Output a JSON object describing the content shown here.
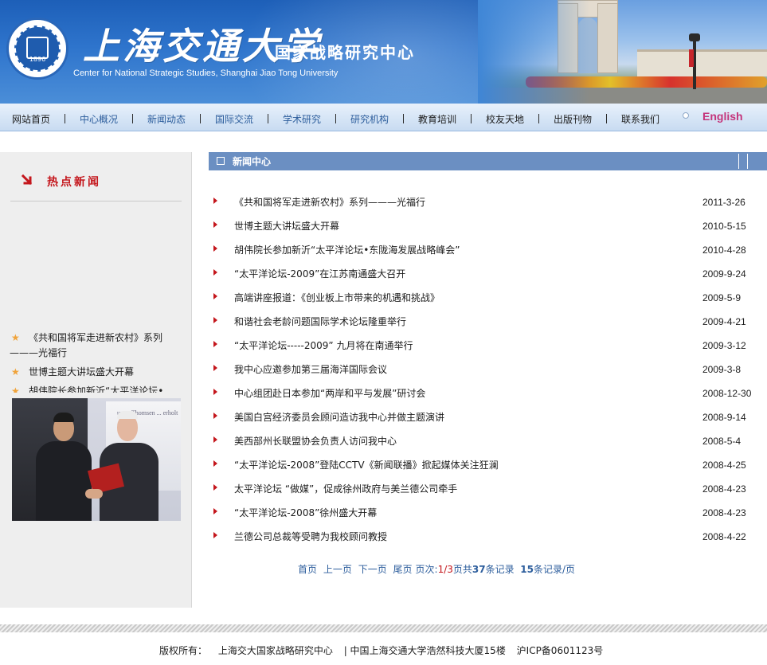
{
  "header": {
    "university_name": "上海交通大学",
    "center_name_cn": "国家战略研究中心",
    "center_name_en": "Center for National Strategic Studies, Shanghai Jiao Tong University",
    "seal_year": "1896"
  },
  "nav": {
    "items": [
      {
        "label": "网站首页"
      },
      {
        "label": "中心概况"
      },
      {
        "label": "新闻动态"
      },
      {
        "label": "国际交流"
      },
      {
        "label": "学术研究"
      },
      {
        "label": "研究机构"
      },
      {
        "label": "教育培训"
      },
      {
        "label": "校友天地"
      },
      {
        "label": "出版刊物"
      },
      {
        "label": "联系我们"
      }
    ],
    "english": "English"
  },
  "sidebar": {
    "hot_news_title": "热点新闻",
    "hot_items": [
      {
        "title": "《共和国将军走进新农村》系列———光福行"
      },
      {
        "title": "世博主题大讲坛盛大开幕"
      },
      {
        "title": "胡伟院长参加新沂“太平洋论坛•东陇海发展战略峰会”"
      }
    ],
    "photo_caption": "upon Thomsen ... erholt"
  },
  "news": {
    "section_title": "新闻中心",
    "items": [
      {
        "title": "《共和国将军走进新农村》系列———光福行",
        "date": "2011-3-26"
      },
      {
        "title": "世博主题大讲坛盛大开幕",
        "date": "2010-5-15"
      },
      {
        "title": "胡伟院长参加新沂“太平洋论坛•东陇海发展战略峰会”",
        "date": "2010-4-28"
      },
      {
        "title": "“太平洋论坛-2009”在江苏南通盛大召开",
        "date": "2009-9-24"
      },
      {
        "title": "高端讲座报道：《创业板上市带来的机遇和挑战》",
        "date": "2009-5-9"
      },
      {
        "title": "和谐社会老龄问题国际学术论坛隆重举行",
        "date": "2009-4-21"
      },
      {
        "title": "“太平洋论坛-----2009” 九月将在南通举行",
        "date": "2009-3-12"
      },
      {
        "title": "我中心应邀参加第三届海洋国际会议",
        "date": "2009-3-8"
      },
      {
        "title": "中心组团赴日本参加“两岸和平与发展”研讨会",
        "date": "2008-12-30"
      },
      {
        "title": "美国白宫经济委员会顾问造访我中心并做主题演讲",
        "date": "2008-9-14"
      },
      {
        "title": "美西部州长联盟协会负责人访问我中心",
        "date": "2008-5-4"
      },
      {
        "title": "“太平洋论坛-2008”登陆CCTV《新闻联播》掀起媒体关注狂澜",
        "date": "2008-4-25"
      },
      {
        "title": "太平洋论坛  “做媒”，促成徐州政府与美兰德公司牵手",
        "date": "2008-4-23"
      },
      {
        "title": "“太平洋论坛-2008”徐州盛大开幕",
        "date": "2008-4-23"
      },
      {
        "title": "兰德公司总裁等受聘为我校顾问教授",
        "date": "2008-4-22"
      }
    ]
  },
  "pager": {
    "first": "首页",
    "prev": "上一页",
    "next": "下一页",
    "last": "尾页",
    "page_label": "页次:",
    "page_value": "1/3",
    "page_unit": "页共",
    "total": "37",
    "total_unit": "条记录",
    "per_page": "15",
    "per_page_unit": "条记录/页"
  },
  "footer": {
    "copyright_label": "版权所有：",
    "owner": "上海交大国家战略研究中心",
    "address": "| 中国上海交通大学浩然科技大厦15楼",
    "icp": "沪ICP备0601123号"
  },
  "colors": {
    "banner_blue": "#2e74cc",
    "nav_link": "#2c5d9c",
    "accent_red": "#c4161c",
    "english_pink": "#c4347b",
    "section_head": "#6b8fc2"
  }
}
